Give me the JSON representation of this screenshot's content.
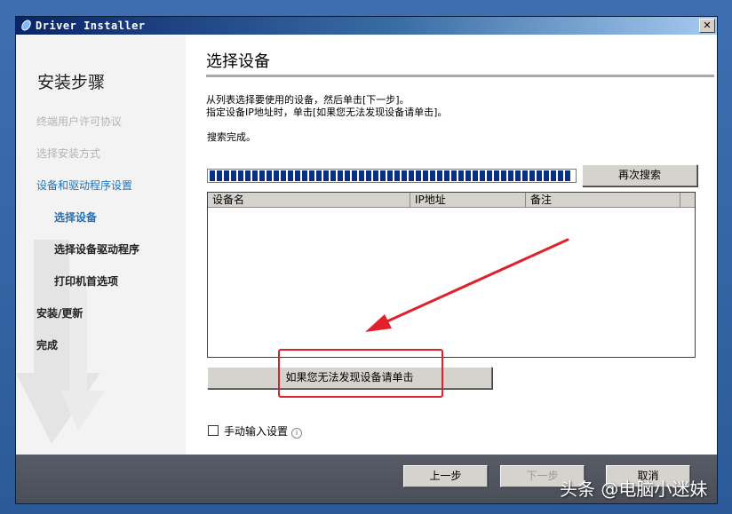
{
  "window": {
    "title": "Driver Installer",
    "close_label": "✕"
  },
  "sidebar": {
    "heading": "安装步骤",
    "steps": [
      {
        "label": "终端用户许可协议",
        "state": "done"
      },
      {
        "label": "选择安装方式",
        "state": "done"
      },
      {
        "label": "设备和驱动程序设置",
        "state": "active"
      },
      {
        "label": "选择设备",
        "state": "current"
      },
      {
        "label": "选择设备驱动程序",
        "state": "pending"
      },
      {
        "label": "打印机首选项",
        "state": "pending"
      },
      {
        "label": "安装/更新",
        "state": "pending"
      },
      {
        "label": "完成",
        "state": "pending"
      }
    ]
  },
  "main": {
    "title": "选择设备",
    "instructions": [
      "从列表选择要使用的设备，然后单击[下一步]。",
      "指定设备IP地址时，单击[如果您无法发现设备请单击]。"
    ],
    "search_status": "搜索完成。",
    "progress": 1.0,
    "research_button": "再次搜索",
    "table": {
      "columns": [
        "设备名",
        "IP地址",
        "备注"
      ],
      "rows": []
    },
    "not_found_button": "如果您无法发现设备请单击",
    "manual_input": {
      "label": "手动输入设置",
      "checked": false
    }
  },
  "footer": {
    "back_button": "上一步",
    "next_button": "下一步",
    "cancel_button": "取消",
    "next_enabled": false
  },
  "overlay": {
    "watermark": "头条 @电脑小迷妹"
  },
  "colors": {
    "accent_blue": "#1e73be",
    "highlight_red": "#e0202a",
    "progress_fill": "#0a2f86"
  }
}
